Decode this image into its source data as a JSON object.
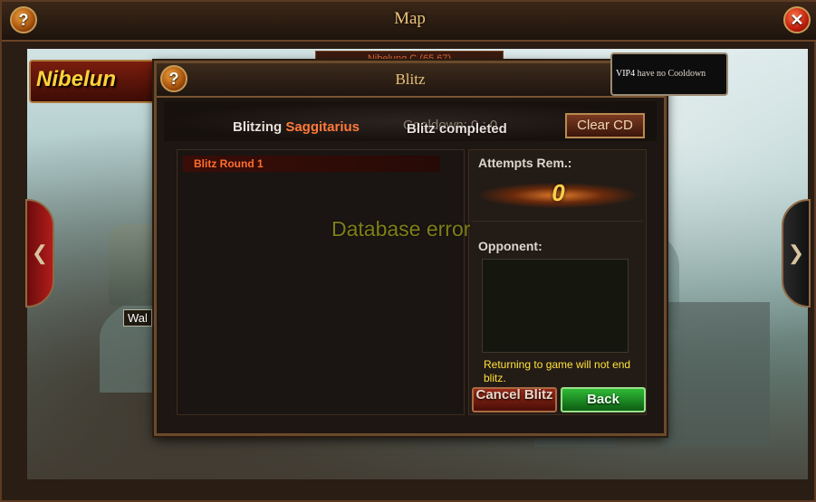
{
  "map_window": {
    "title": "Map",
    "help_glyph": "?",
    "close_glyph": "✕",
    "area_name": "Nibelun",
    "location_label": "Nibelung C (65,67)",
    "waypoint_label": "Wal",
    "nav_left_glyph": "❮",
    "nav_right_glyph": "❯"
  },
  "blitz_dialog": {
    "title": "Blitz",
    "help_glyph": "?",
    "blitzing_prefix": "Blitzing ",
    "target_name": "Saggitarius",
    "cooldown_text": "Cooldown: 0 : 0",
    "status_text": "Blitz completed",
    "clear_cd_label": "Clear CD",
    "vip_tooltip": {
      "vip": "VIP4",
      "rest": " have no Cooldown"
    },
    "rounds": [
      {
        "label": "Blitz Round 1"
      }
    ],
    "attempts_label": "Attempts Rem.:",
    "attempts_value": "0",
    "opponent_label": "Opponent:",
    "return_note": "Returning to game will not end blitz.",
    "cancel_label": "Cancel Blitz",
    "back_label": "Back"
  },
  "overlay": {
    "error_text": "Database error"
  },
  "colors": {
    "accent": "#ff7a3a",
    "gold": "#ffcf4a",
    "back_green": "#2fba36",
    "cancel_red": "#9a2a1a"
  }
}
